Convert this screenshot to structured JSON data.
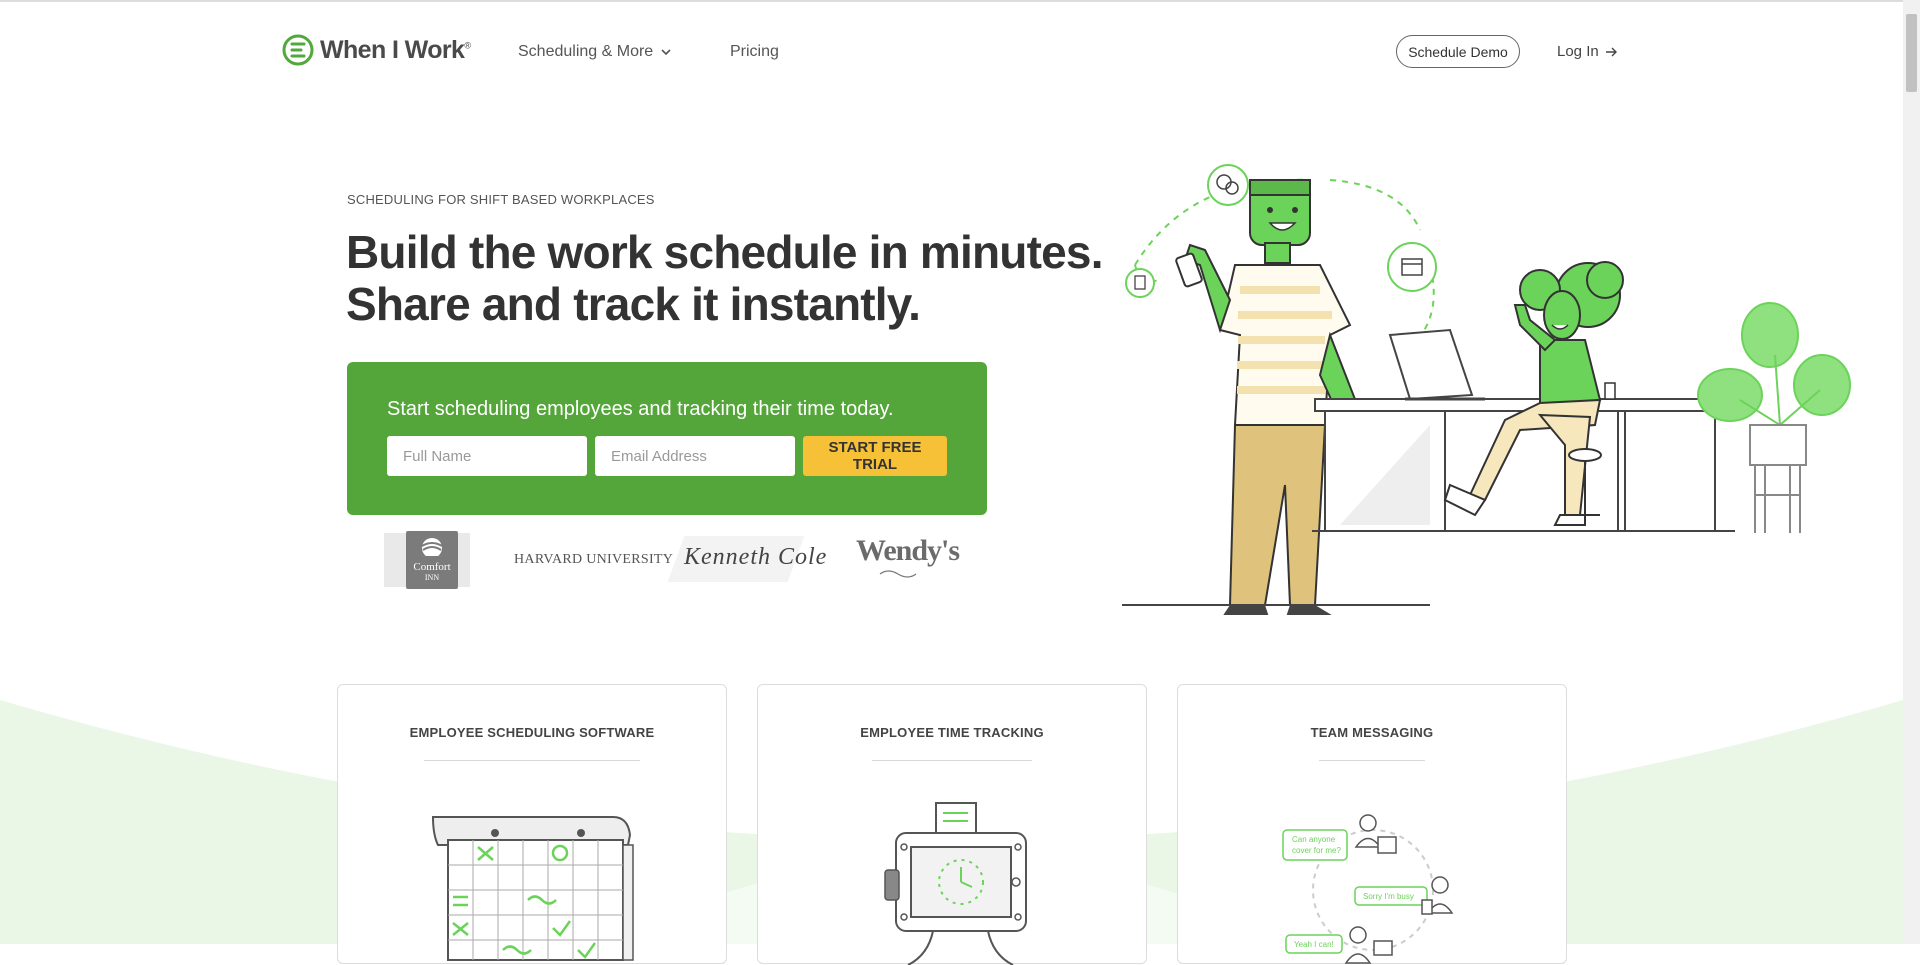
{
  "header": {
    "logo_text": "When I Work",
    "logo_mark": "®",
    "nav": {
      "scheduling": "Scheduling & More",
      "pricing": "Pricing"
    },
    "schedule_demo": "Schedule Demo",
    "login": "Log In"
  },
  "hero": {
    "eyebrow": "SCHEDULING FOR SHIFT BASED WORKPLACES",
    "headline_line1": "Build the work schedule in minutes.",
    "headline_line2": "Share and track it instantly.",
    "signup": {
      "text": "Start scheduling employees and tracking their time today.",
      "name_placeholder": "Full Name",
      "email_placeholder": "Email Address",
      "cta": "START FREE TRIAL"
    },
    "customer_logos": {
      "comfort_line1": "Comfort",
      "comfort_line2": "INN",
      "harvard": "HARVARD UNIVERSITY",
      "kenneth": "Kenneth Cole",
      "wendys": "Wendy's"
    }
  },
  "features": [
    {
      "title": "EMPLOYEE SCHEDULING SOFTWARE"
    },
    {
      "title": "EMPLOYEE TIME TRACKING"
    },
    {
      "title": "TEAM MESSAGING",
      "bubbles": [
        "Can anyone",
        "cover for me?",
        "Sorry I'm busy",
        "Yeah I can!"
      ]
    }
  ],
  "colors": {
    "brand_green": "#55a63a",
    "cta_yellow": "#f7c137",
    "illustration_green": "#6cd35a",
    "soft_green_bg": "#eaf6e6"
  },
  "icons": [
    "logo-mark-icon",
    "chevron-down-icon",
    "arrow-right-icon"
  ]
}
